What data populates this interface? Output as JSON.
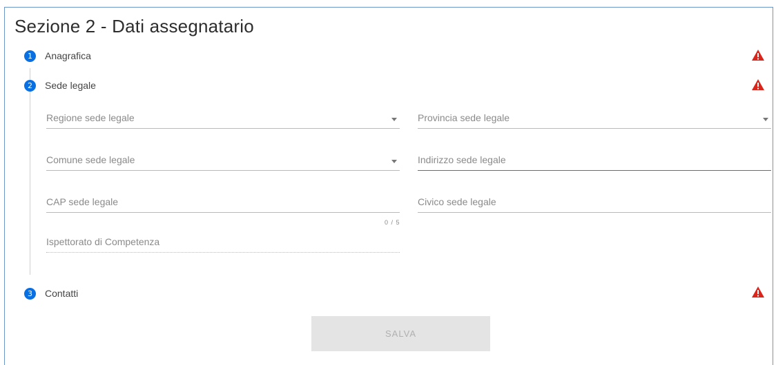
{
  "section": {
    "title": "Sezione 2 - Dati assegnatario"
  },
  "steps": [
    {
      "number": "1",
      "label": "Anagrafica"
    },
    {
      "number": "2",
      "label": "Sede legale"
    },
    {
      "number": "3",
      "label": "Contatti"
    }
  ],
  "form": {
    "regione": {
      "placeholder": "Regione sede legale",
      "type": "select"
    },
    "provincia": {
      "placeholder": "Provincia sede legale",
      "type": "select"
    },
    "comune": {
      "placeholder": "Comune sede legale",
      "type": "select"
    },
    "indirizzo": {
      "placeholder": "Indirizzo sede legale",
      "type": "text"
    },
    "cap": {
      "placeholder": "CAP sede legale",
      "type": "text",
      "counter": "0 / 5"
    },
    "civico": {
      "placeholder": "Civico sede legale",
      "type": "text"
    },
    "ispettorato": {
      "placeholder": "Ispettorato di Competenza",
      "type": "text",
      "disabled": true
    }
  },
  "actions": {
    "save_label": "SALVA"
  },
  "colors": {
    "step_blue": "#0a6fe0",
    "warning_red": "#d9261c",
    "panel_border": "#6c96c9"
  }
}
